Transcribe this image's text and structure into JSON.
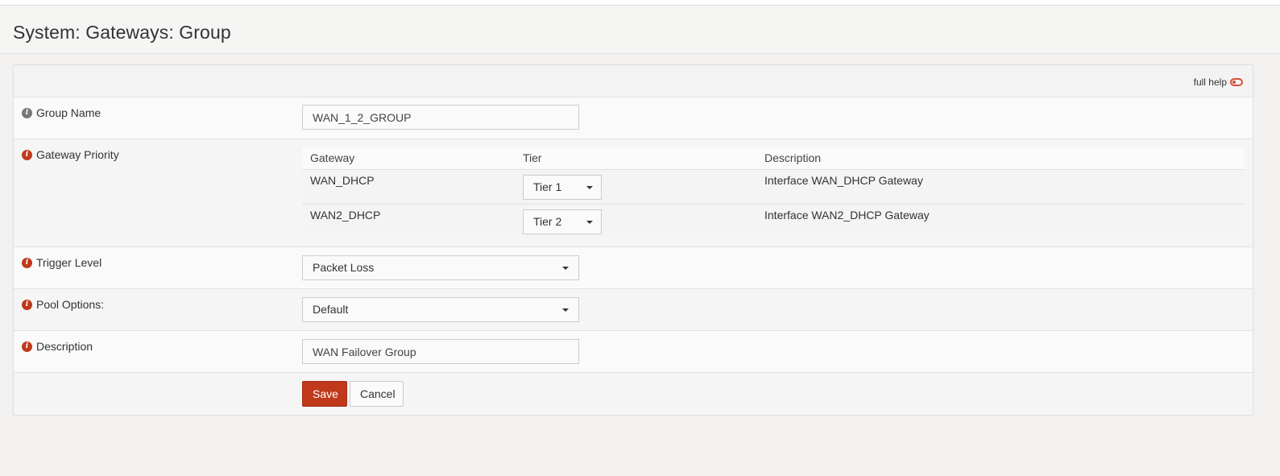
{
  "page": {
    "title": "System: Gateways: Group"
  },
  "help": {
    "label": "full help"
  },
  "form": {
    "group_name": {
      "label": "Group Name",
      "value": "WAN_1_2_GROUP"
    },
    "gateway_priority": {
      "label": "Gateway Priority",
      "columns": [
        "Gateway",
        "Tier",
        "Description"
      ],
      "rows": [
        {
          "gateway": "WAN_DHCP",
          "tier": "Tier 1",
          "description": "Interface WAN_DHCP Gateway"
        },
        {
          "gateway": "WAN2_DHCP",
          "tier": "Tier 2",
          "description": "Interface WAN2_DHCP Gateway"
        }
      ]
    },
    "trigger_level": {
      "label": "Trigger Level",
      "value": "Packet Loss"
    },
    "pool_options": {
      "label": "Pool Options:",
      "value": "Default"
    },
    "description": {
      "label": "Description",
      "value": "WAN Failover Group"
    }
  },
  "buttons": {
    "save": "Save",
    "cancel": "Cancel"
  },
  "colors": {
    "accent": "#c0391b",
    "info_grey": "#777777"
  },
  "icons": {
    "info": "info-icon",
    "toggle": "toggle-icon",
    "caret": "caret-down-icon"
  }
}
